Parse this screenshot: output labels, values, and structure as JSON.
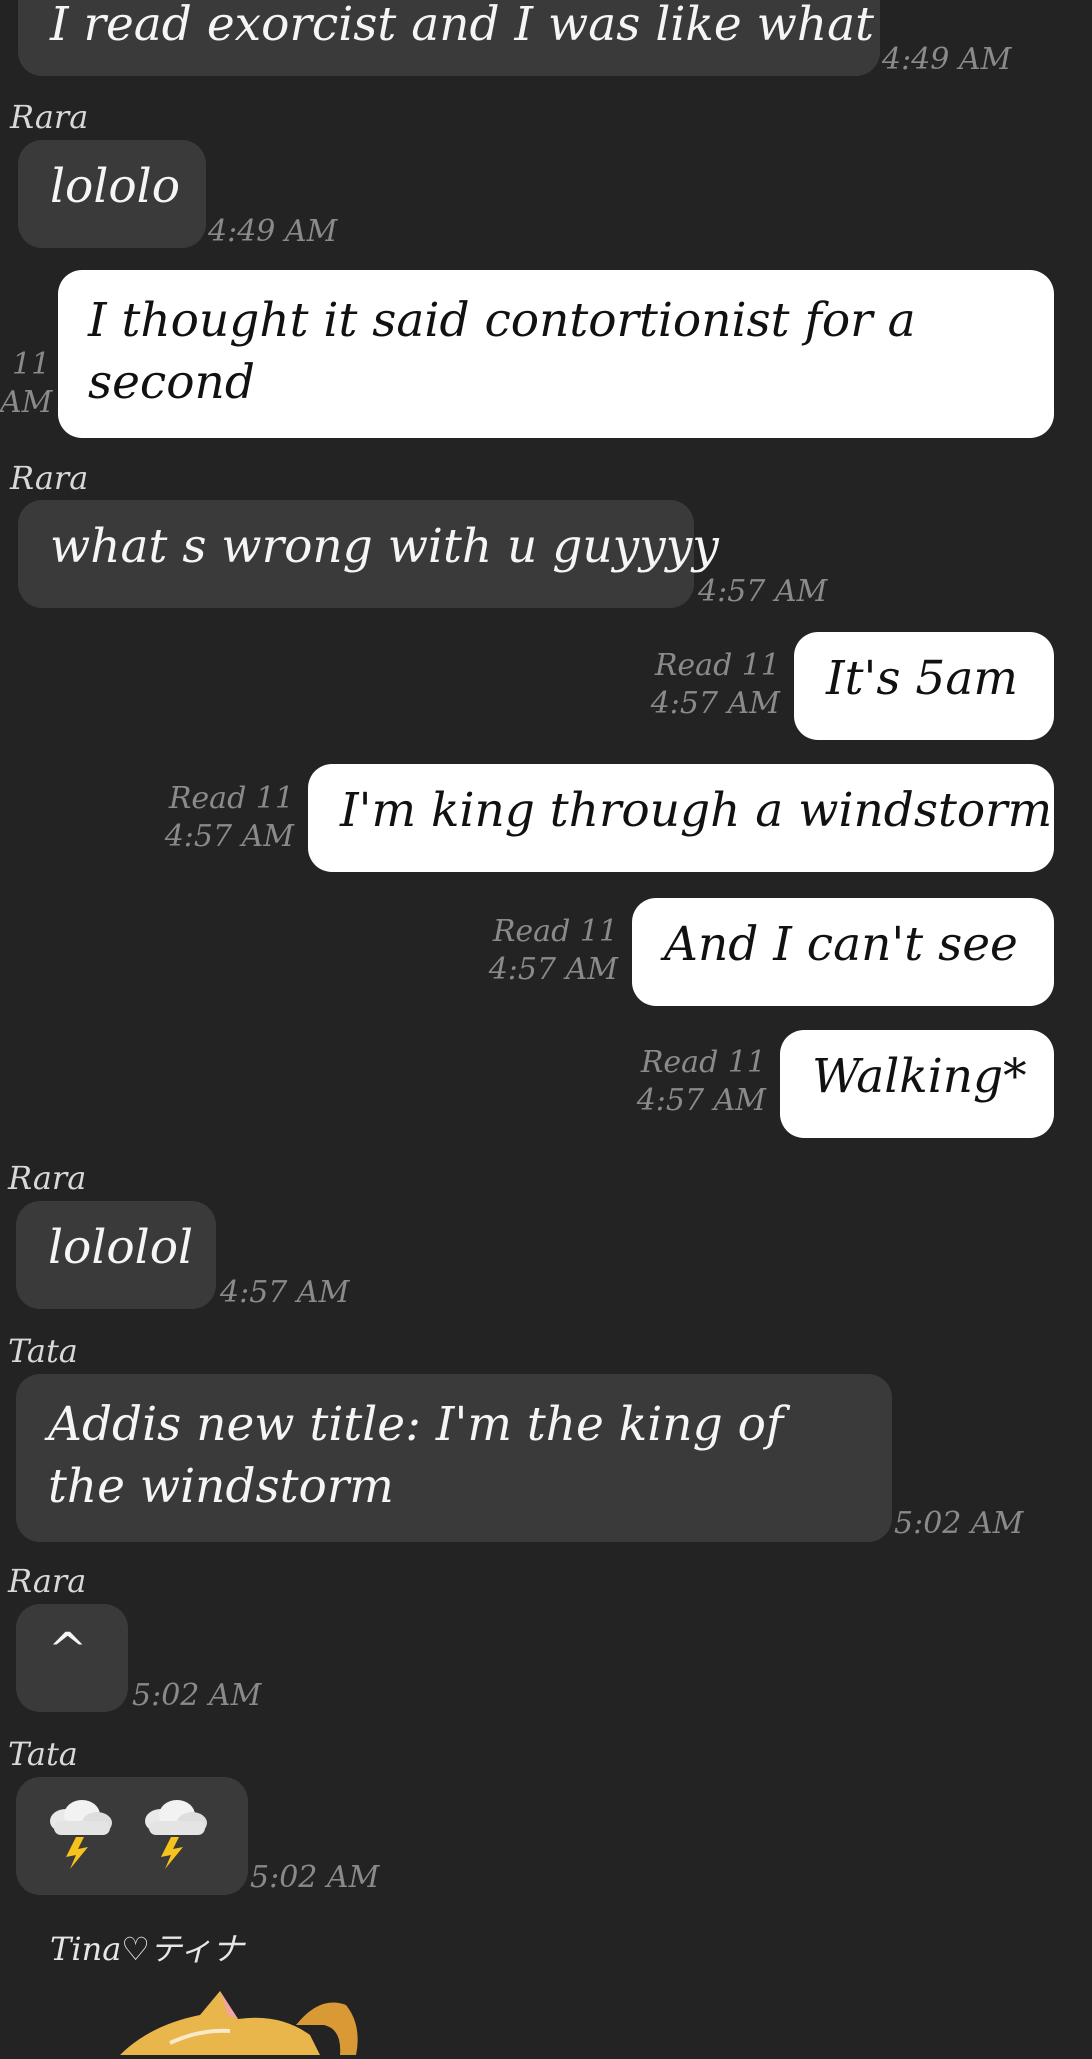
{
  "messages": [
    {
      "text": "I read exorcist and I was like what",
      "time": "4:49 AM"
    },
    {
      "sender": "Rara",
      "text": "lololo",
      "time": "4:49 AM"
    },
    {
      "text": "I thought it said contortionist for a second",
      "read": "11",
      "time": "AM"
    },
    {
      "sender": "Rara",
      "text": "what s wrong with u guyyyy",
      "time": "4:57 AM"
    },
    {
      "text": "It's 5am",
      "read": "Read 11",
      "time": "4:57 AM"
    },
    {
      "text": "I'm king through a windstorm",
      "read": "Read 11",
      "time": "4:57 AM"
    },
    {
      "text": "And I can't see",
      "read": "Read 11",
      "time": "4:57 AM"
    },
    {
      "text": "Walking*",
      "read": "Read 11",
      "time": "4:57 AM"
    },
    {
      "sender": "Rara",
      "text": "lololol",
      "time": "4:57 AM"
    },
    {
      "sender": "Tata",
      "text": "Addis new title: I'm the king of the windstorm",
      "time": "5:02 AM"
    },
    {
      "sender": "Rara",
      "text": "^",
      "time": "5:02 AM"
    },
    {
      "sender": "Tata",
      "icons": [
        "thunderstorm-icon",
        "thunderstorm-icon"
      ],
      "time": "5:02 AM"
    }
  ],
  "last_sender": "Tina♡ティナ",
  "colors": {
    "background": "#232323",
    "incoming_bubble": "#3a3a3a",
    "outgoing_bubble": "#ffffff",
    "meta_text": "#8a8a8a"
  }
}
